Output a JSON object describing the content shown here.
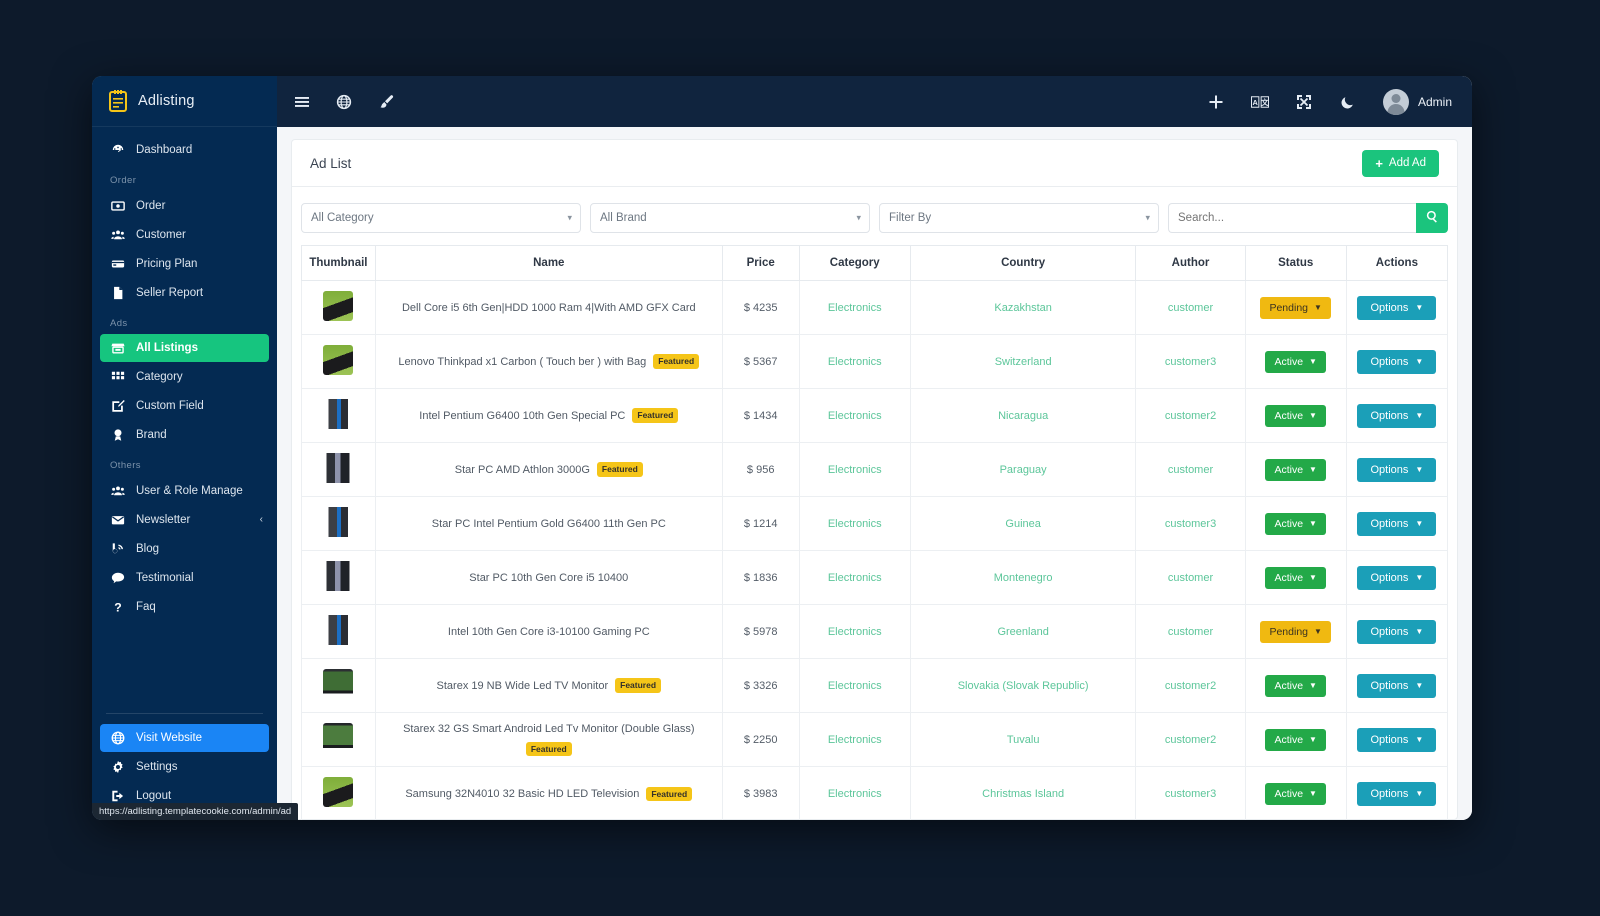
{
  "brand": {
    "title": "Adlisting",
    "icon": "clipboard-icon"
  },
  "sidebar": {
    "groups": [
      {
        "label": "",
        "items": [
          {
            "label": "Dashboard",
            "icon": "speedometer-icon",
            "state": "normal"
          }
        ]
      },
      {
        "label": "Order",
        "items": [
          {
            "label": "Order",
            "icon": "money-icon",
            "state": "normal"
          },
          {
            "label": "Customer",
            "icon": "users-icon",
            "state": "normal"
          },
          {
            "label": "Pricing Plan",
            "icon": "card-icon",
            "state": "normal"
          },
          {
            "label": "Seller Report",
            "icon": "file-icon",
            "state": "normal"
          }
        ]
      },
      {
        "label": "Ads",
        "items": [
          {
            "label": "All Listings",
            "icon": "store-icon",
            "state": "active"
          },
          {
            "label": "Category",
            "icon": "grid-icon",
            "state": "normal"
          },
          {
            "label": "Custom Field",
            "icon": "edit-square-icon",
            "state": "normal"
          },
          {
            "label": "Brand",
            "icon": "award-icon",
            "state": "normal"
          }
        ]
      },
      {
        "label": "Others",
        "items": [
          {
            "label": "User & Role Manage",
            "icon": "users-icon",
            "state": "normal"
          },
          {
            "label": "Newsletter",
            "icon": "envelope-icon",
            "state": "normal",
            "chevron": "‹"
          },
          {
            "label": "Blog",
            "icon": "blog-icon",
            "state": "normal"
          },
          {
            "label": "Testimonial",
            "icon": "comment-icon",
            "state": "normal"
          },
          {
            "label": "Faq",
            "icon": "question-icon",
            "state": "normal"
          }
        ]
      }
    ],
    "bottom": [
      {
        "label": "Visit Website",
        "icon": "globe-icon",
        "state": "visit"
      },
      {
        "label": "Settings",
        "icon": "gear-icon",
        "state": "normal"
      },
      {
        "label": "Logout",
        "icon": "logout-icon",
        "state": "normal"
      }
    ]
  },
  "topbar": {
    "left_icons": [
      "hamburger-icon",
      "globe-icon",
      "paint-brush-icon"
    ],
    "right_icons": [
      "plus-icon",
      "translate-icon",
      "fullscreen-icon",
      "moon-icon"
    ],
    "admin_label": "Admin"
  },
  "page": {
    "title": "Ad List",
    "add_button": "Add Ad",
    "add_button_color": "#1bc47d"
  },
  "filters": {
    "category": "All Category",
    "brand": "All Brand",
    "filter_by": "Filter By",
    "search_placeholder": "Search...",
    "search_value": "",
    "search_icon": "search-icon"
  },
  "table": {
    "headers": [
      "Thumbnail",
      "Name",
      "Price",
      "Category",
      "Country",
      "Author",
      "Status",
      "Actions"
    ],
    "options_label": "Options",
    "featured_label": "Featured",
    "rows": [
      {
        "thumb": "th-laptop",
        "name": "Dell Core i5 6th Gen|HDD 1000 Ram 4|With AMD GFX Card",
        "featured": false,
        "price": "$ 4235",
        "category": "Electronics",
        "country": "Kazakhstan",
        "author": "customer",
        "status": "Pending"
      },
      {
        "thumb": "th-laptop",
        "name": "Lenovo Thinkpad x1 Carbon ( Touch ber ) with Bag",
        "featured": true,
        "price": "$ 5367",
        "category": "Electronics",
        "country": "Switzerland",
        "author": "customer3",
        "status": "Active"
      },
      {
        "thumb": "th-pc",
        "name": "Intel Pentium G6400 10th Gen Special PC",
        "featured": true,
        "price": "$ 1434",
        "category": "Electronics",
        "country": "Nicaragua",
        "author": "customer2",
        "status": "Active"
      },
      {
        "thumb": "th-pc2",
        "name": "Star PC AMD Athlon 3000G",
        "featured": true,
        "price": "$ 956",
        "category": "Electronics",
        "country": "Paraguay",
        "author": "customer",
        "status": "Active"
      },
      {
        "thumb": "th-pc",
        "name": "Star PC Intel Pentium Gold G6400 11th Gen PC",
        "featured": false,
        "price": "$ 1214",
        "category": "Electronics",
        "country": "Guinea",
        "author": "customer3",
        "status": "Active"
      },
      {
        "thumb": "th-pc2",
        "name": "Star PC 10th Gen Core i5 10400",
        "featured": false,
        "price": "$ 1836",
        "category": "Electronics",
        "country": "Montenegro",
        "author": "customer",
        "status": "Active"
      },
      {
        "thumb": "th-pc",
        "name": "Intel 10th Gen Core i3-10100 Gaming PC",
        "featured": false,
        "price": "$ 5978",
        "category": "Electronics",
        "country": "Greenland",
        "author": "customer",
        "status": "Pending"
      },
      {
        "thumb": "th-tv",
        "name": "Starex 19 NB Wide Led TV Monitor",
        "featured": true,
        "price": "$ 3326",
        "category": "Electronics",
        "country": "Slovakia (Slovak Republic)",
        "author": "customer2",
        "status": "Active"
      },
      {
        "thumb": "th-tv2",
        "name": "Starex 32 GS Smart Android Led Tv Monitor (Double Glass)",
        "featured": true,
        "price": "$ 2250",
        "category": "Electronics",
        "country": "Tuvalu",
        "author": "customer2",
        "status": "Active"
      },
      {
        "thumb": "th-laptop",
        "name": "Samsung 32N4010 32 Basic HD LED Television",
        "featured": true,
        "price": "$ 3983",
        "category": "Electronics",
        "country": "Christmas Island",
        "author": "customer3",
        "status": "Active"
      }
    ]
  },
  "status_bar": {
    "url": "https://adlisting.templatecookie.com/admin/ad"
  },
  "colors": {
    "sidebar": "#042a52",
    "topbar": "#10243e",
    "accent_green": "#1bc47d",
    "accent_blue": "#1a85f5",
    "status_active": "#23a948",
    "status_pending": "#f0b911",
    "options": "#1b9fb8",
    "link_green": "#5cc69a",
    "featured": "#f5c518"
  }
}
